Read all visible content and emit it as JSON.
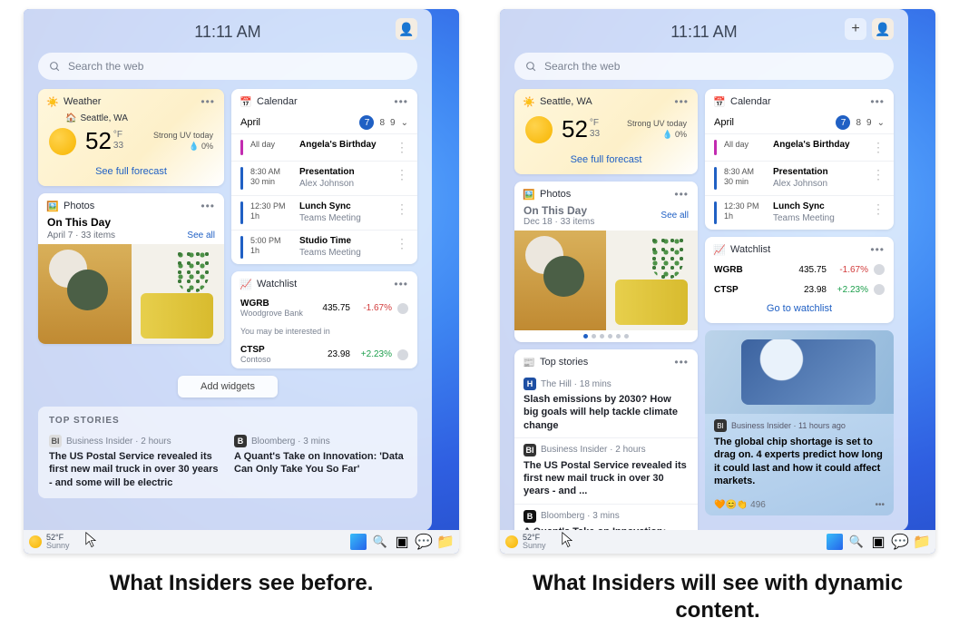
{
  "captions": {
    "left": "What Insiders see before.",
    "right": "What Insiders will see with dynamic content."
  },
  "panel": {
    "time": "11:11 AM",
    "avatar": "👤",
    "plus": "+",
    "search_placeholder": "Search the web"
  },
  "weather": {
    "title": "Weather",
    "title_right": "Seattle, WA",
    "location": "Seattle, WA",
    "temp": "52",
    "unit_top": "°F",
    "unit_bot": "33",
    "cond": "Strong UV today",
    "precip": "0%",
    "link": "See full forecast"
  },
  "photos": {
    "title": "Photos",
    "sub": "On This Day",
    "meta_left": "April 7 · 33 items",
    "meta_right": "Dec 18 · 33 items",
    "see": "See all"
  },
  "calendar": {
    "title": "Calendar",
    "month": "April",
    "dates": [
      "7",
      "8",
      "9"
    ],
    "events": [
      {
        "color": "#c22bb0",
        "time_a": "All day",
        "time_b": "",
        "title": "Angela's Birthday",
        "sub": ""
      },
      {
        "color": "#2060c4",
        "time_a": "8:30 AM",
        "time_b": "30 min",
        "title": "Presentation",
        "sub": "Alex Johnson"
      },
      {
        "color": "#2060c4",
        "time_a": "12:30 PM",
        "time_b": "1h",
        "title": "Lunch Sync",
        "sub": "Teams Meeting"
      },
      {
        "color": "#2060c4",
        "time_a": "5:00 PM",
        "time_b": "1h",
        "title": "Studio Time",
        "sub": "Teams Meeting"
      }
    ]
  },
  "watchlist": {
    "title": "Watchlist",
    "rows": [
      {
        "sym": "WGRB",
        "sub": "Woodgrove Bank",
        "price": "435.75",
        "pct": "-1.67%",
        "cls": "down"
      },
      {
        "sym": "CTSP",
        "sub": "Contoso",
        "price": "23.98",
        "pct": "+2.23%",
        "cls": "up"
      }
    ],
    "note": "You may be interested in",
    "link": "Go to watchlist"
  },
  "add_widgets": "Add widgets",
  "topstories": {
    "label": "TOP STORIES",
    "left": {
      "badge": "BI",
      "src": "Business Insider · 2 hours",
      "hl": "The US Postal Service revealed its first new mail truck in over 30 years - and some will be electric"
    },
    "right": {
      "badge": "B",
      "src": "Bloomberg · 3 mins",
      "hl": "A Quant's Take on Innovation: 'Data Can Only Take You So Far'"
    }
  },
  "topstories2": {
    "title": "Top stories",
    "items": [
      {
        "badge": "H",
        "badge_bg": "#1e4fa3",
        "src": "The Hill · 18 mins",
        "hl": "Slash emissions by 2030? How big goals will help tackle climate change"
      },
      {
        "badge": "BI",
        "badge_bg": "#333",
        "src": "Business Insider · 2 hours",
        "hl": "The US Postal Service revealed its first new mail truck in over 30 years - and ..."
      },
      {
        "badge": "B",
        "badge_bg": "#111",
        "src": "Bloomberg · 3 mins",
        "hl": "A Quant's Take on Innovation: 'Data Can Only Take You So Far'"
      }
    ]
  },
  "feature": {
    "src_badge": "BI",
    "src": "Business Insider · 11 hours ago",
    "hl": "The global chip shortage is set to drag on. 4 experts predict how long it could last and how it could affect markets.",
    "reactions": "496"
  },
  "taskbar": {
    "temp": "52°F",
    "cond": "Sunny"
  }
}
